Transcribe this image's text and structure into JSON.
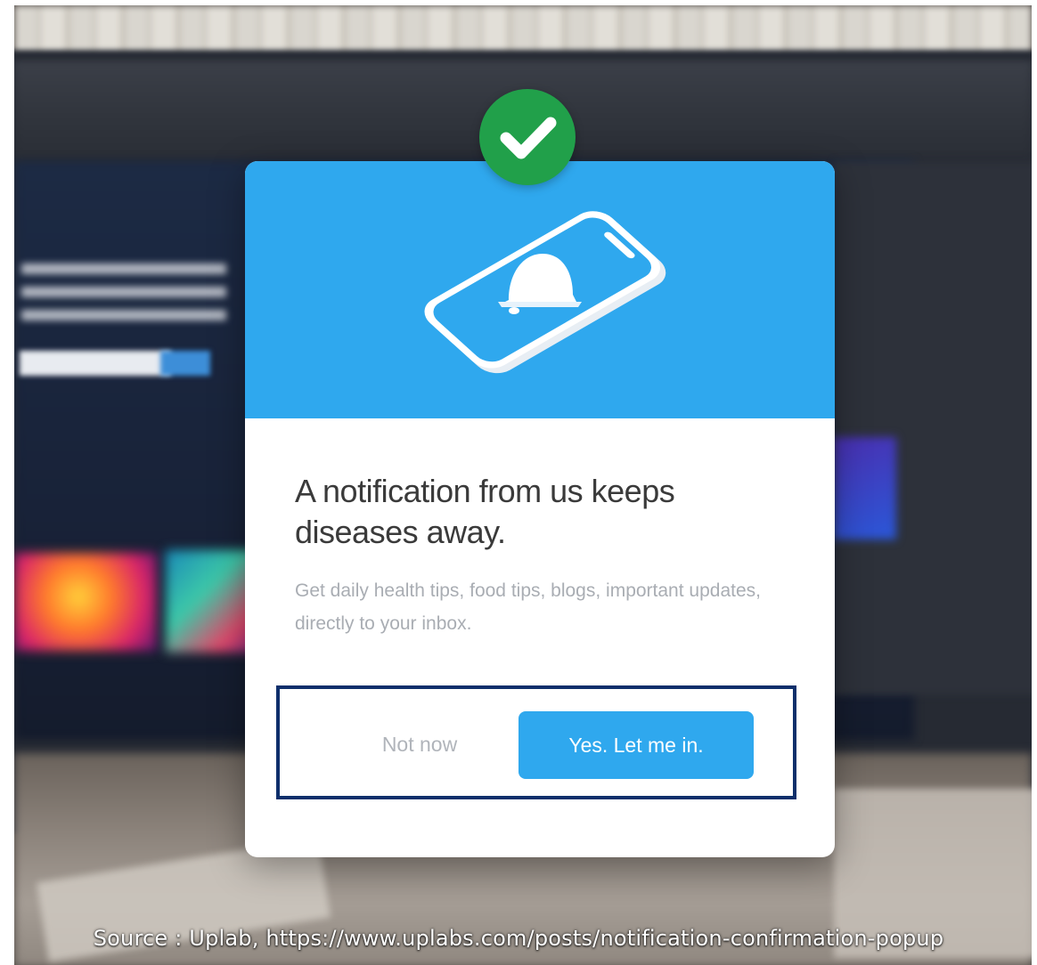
{
  "popup": {
    "title": "A notification from us keeps diseases away.",
    "subtitle": "Get daily health tips, food tips, blogs, important updates, directly to your inbox.",
    "secondary_button": "Not now",
    "primary_button": "Yes. Let me in.",
    "hero_icon": "phone-bell-icon",
    "badge_icon": "checkmark-icon"
  },
  "caption": "Source : Uplab, https://www.uplabs.com/posts/notification-confirmation-popup",
  "colors": {
    "accent": "#2fa8ee",
    "badge": "#21a04a",
    "highlight_border": "#0e2f6b",
    "title_text": "#3a3a3a",
    "muted_text": "#a9adb3"
  }
}
